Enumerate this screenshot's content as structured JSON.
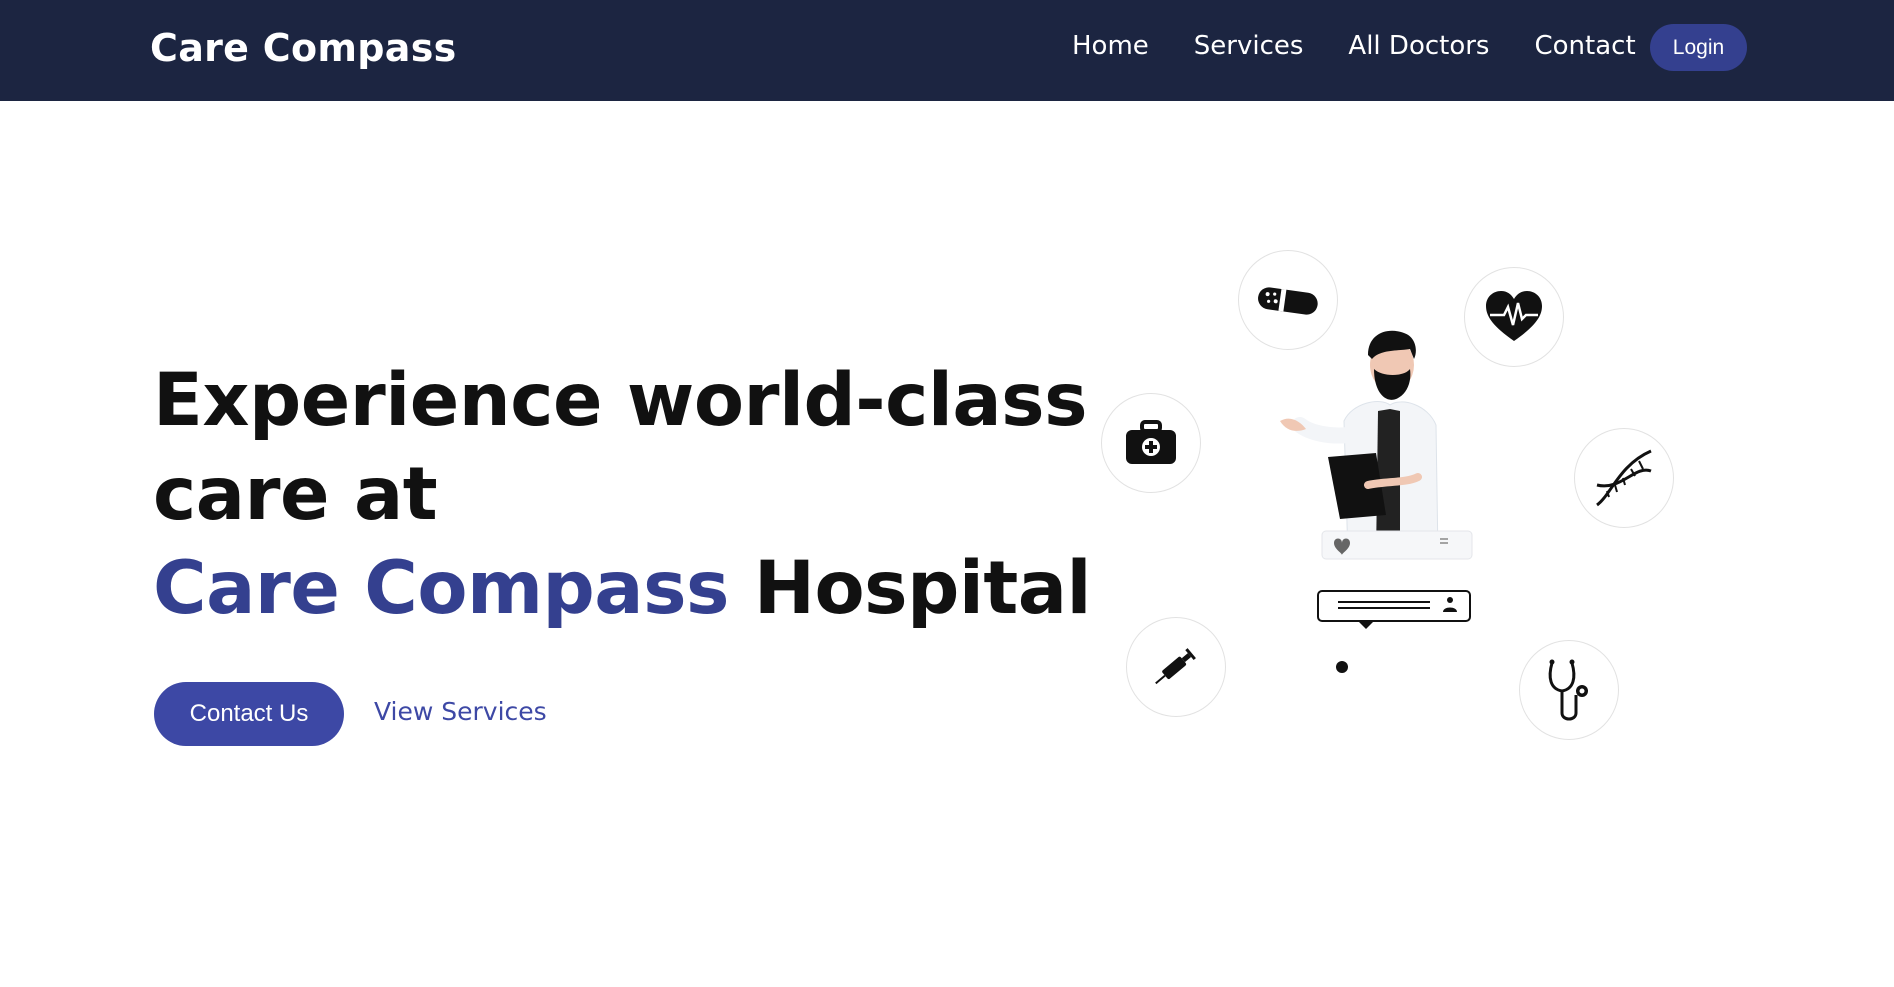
{
  "navbar": {
    "brand": "Care Compass",
    "links": [
      {
        "label": "Home"
      },
      {
        "label": "Services"
      },
      {
        "label": "All Doctors"
      },
      {
        "label": "Contact"
      }
    ],
    "login_label": "Login"
  },
  "hero": {
    "title_line1": "Experience world-class",
    "title_line2": "care at",
    "title_accent": "Care Compass",
    "title_suffix": " Hospital",
    "primary_button": "Contact Us",
    "secondary_link": "View Services"
  },
  "illustration": {
    "icons": [
      "bandage-icon",
      "heart-rate-icon",
      "first-aid-kit-icon",
      "dna-icon",
      "syringe-icon",
      "stethoscope-icon"
    ]
  },
  "colors": {
    "navbar_bg": "#1c2541",
    "accent": "#34408f",
    "button": "#3d48a5"
  }
}
